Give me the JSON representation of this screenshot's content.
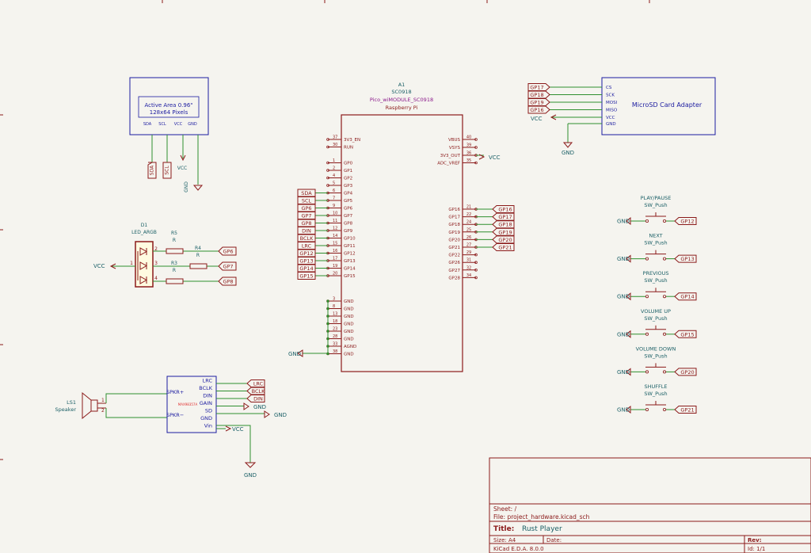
{
  "oled": {
    "line1": "Active Area 0.96\"",
    "line2": "128x64 Pixels",
    "pins": [
      "SDA",
      "SCL",
      "VCC",
      "GND"
    ],
    "sda": "SDA",
    "scl": "SCL",
    "vcc": "VCC",
    "gnd": "GND"
  },
  "led": {
    "ref": "D1",
    "value": "LED_ARGB",
    "vcc": "VCC",
    "pins": [
      "1",
      "2",
      "3",
      "4"
    ],
    "resistors": [
      {
        "ref": "R5",
        "value": "R",
        "net": "GP6"
      },
      {
        "ref": "R4",
        "value": "R",
        "net": "GP7"
      },
      {
        "ref": "R3",
        "value": "R",
        "net": "GP8"
      }
    ]
  },
  "pico": {
    "ref": "A1",
    "part": "SC0918",
    "module": "Pico_wiMODULE_SC0918",
    "maker": "Raspberry Pi",
    "left_pins": [
      {
        "num": "37",
        "name": "3V3_EN",
        "net": ""
      },
      {
        "num": "30",
        "name": "RUN",
        "net": ""
      },
      {
        "num": "1",
        "name": "GP0",
        "net": ""
      },
      {
        "num": "2",
        "name": "GP1",
        "net": ""
      },
      {
        "num": "4",
        "name": "GP2",
        "net": ""
      },
      {
        "num": "5",
        "name": "GP3",
        "net": ""
      },
      {
        "num": "6",
        "name": "GP4",
        "net": "SDA"
      },
      {
        "num": "7",
        "name": "GP5",
        "net": "SCL"
      },
      {
        "num": "9",
        "name": "GP6",
        "net": "GP6"
      },
      {
        "num": "10",
        "name": "GP7",
        "net": "GP7"
      },
      {
        "num": "11",
        "name": "GP8",
        "net": "GP8"
      },
      {
        "num": "12",
        "name": "GP9",
        "net": "DIN"
      },
      {
        "num": "14",
        "name": "GP10",
        "net": "BCLK"
      },
      {
        "num": "15",
        "name": "GP11",
        "net": "LRC"
      },
      {
        "num": "16",
        "name": "GP12",
        "net": "GP12"
      },
      {
        "num": "17",
        "name": "GP13",
        "net": "GP13"
      },
      {
        "num": "19",
        "name": "GP14",
        "net": "GP14"
      },
      {
        "num": "20",
        "name": "GP15",
        "net": "GP15"
      },
      {
        "num": "3",
        "name": "GND",
        "net": ""
      },
      {
        "num": "8",
        "name": "GND",
        "net": ""
      },
      {
        "num": "13",
        "name": "GND",
        "net": ""
      },
      {
        "num": "18",
        "name": "GND",
        "net": ""
      },
      {
        "num": "23",
        "name": "GND",
        "net": ""
      },
      {
        "num": "28",
        "name": "GND",
        "net": ""
      },
      {
        "num": "33",
        "name": "AGND",
        "net": ""
      },
      {
        "num": "38",
        "name": "GND",
        "net": ""
      }
    ],
    "right_pins": [
      {
        "num": "40",
        "name": "VBUS",
        "net": ""
      },
      {
        "num": "39",
        "name": "VSYS",
        "net": ""
      },
      {
        "num": "36",
        "name": "3V3_OUT",
        "net": "VCC"
      },
      {
        "num": "35",
        "name": "ADC_VREF",
        "net": ""
      },
      {
        "num": "21",
        "name": "GP16",
        "net": "GP16"
      },
      {
        "num": "22",
        "name": "GP17",
        "net": "GP17"
      },
      {
        "num": "24",
        "name": "GP18",
        "net": "GP18"
      },
      {
        "num": "25",
        "name": "GP19",
        "net": "GP19"
      },
      {
        "num": "26",
        "name": "GP20",
        "net": "GP20"
      },
      {
        "num": "27",
        "name": "GP21",
        "net": "GP21"
      },
      {
        "num": "29",
        "name": "GP22",
        "net": ""
      },
      {
        "num": "31",
        "name": "GP26",
        "net": ""
      },
      {
        "num": "32",
        "name": "GP27",
        "net": ""
      },
      {
        "num": "34",
        "name": "GP28",
        "net": ""
      }
    ],
    "gnd": "GND"
  },
  "sd": {
    "title": "MicroSD Card Adapter",
    "pins": [
      {
        "name": "CS",
        "net": "GP17"
      },
      {
        "name": "SCK",
        "net": "GP18"
      },
      {
        "name": "MOSI",
        "net": "GP19"
      },
      {
        "name": "MISO",
        "net": "GP16"
      },
      {
        "name": "VCC",
        "net": "VCC"
      },
      {
        "name": "GND",
        "net": "GND"
      }
    ]
  },
  "buttons": [
    {
      "label": "PLAY/PAUSE",
      "part": "SW_Push",
      "net": "GP12",
      "gnd": "GND"
    },
    {
      "label": "NEXT",
      "part": "SW_Push",
      "net": "GP13",
      "gnd": "GND"
    },
    {
      "label": "PREVIOUS",
      "part": "SW_Push",
      "net": "GP14",
      "gnd": "GND"
    },
    {
      "label": "VOLUME UP",
      "part": "SW_Push",
      "net": "GP15",
      "gnd": "GND"
    },
    {
      "label": "VOLUME DOWN",
      "part": "SW_Push",
      "net": "GP20",
      "gnd": "GND"
    },
    {
      "label": "SHUFFLE",
      "part": "SW_Push",
      "net": "GP21",
      "gnd": "GND"
    }
  ],
  "speaker": {
    "ref": "LS1",
    "value": "Speaker",
    "pins": [
      "1",
      "2"
    ]
  },
  "amp": {
    "part": "MAX98357A",
    "left_pins": [
      "SPKR+",
      "SPKR−"
    ],
    "right_pins": [
      "LRC",
      "BCLK",
      "DIN",
      "GAIN",
      "SD",
      "GND",
      "Vin"
    ],
    "labels": [
      "LRC",
      "BCLK",
      "DIN"
    ],
    "gnd": "GND",
    "vcc": "VCC"
  },
  "title_block": {
    "sheet": "Sheet: /",
    "file": "File: project_hardware.kicad_sch",
    "title_label": "Title:",
    "title": "Rust Player",
    "size": "Size: A4",
    "date": "Date:",
    "rev": "Rev:",
    "tool": "KiCad E.D.A. 8.0.0",
    "id": "Id: 1/1"
  },
  "colors": {
    "wire": "#2f8f2f",
    "body": "#8b1a1a",
    "fill": "#fffbe0",
    "text": "#1a5f66",
    "sheet": "#8b1a1a",
    "sd_body": "#1c1ca0",
    "label_text": "#8b1a1a",
    "highlight": "#e03030"
  }
}
